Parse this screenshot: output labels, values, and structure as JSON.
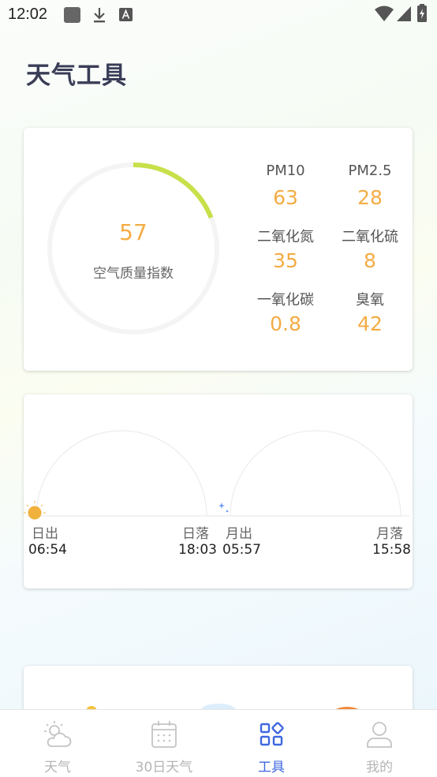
{
  "status_bar": {
    "time": "12:02"
  },
  "page": {
    "title": "天气工具"
  },
  "aqi": {
    "value": "57",
    "label": "空气质量指数",
    "progress_fraction": 0.19,
    "metrics": [
      {
        "name": "PM10",
        "value": "63"
      },
      {
        "name": "PM2.5",
        "value": "28"
      },
      {
        "name": "二氧化氮",
        "value": "35"
      },
      {
        "name": "二氧化硫",
        "value": "8"
      },
      {
        "name": "一氧化碳",
        "value": "0.8"
      },
      {
        "name": "臭氧",
        "value": "42"
      }
    ]
  },
  "sun_moon": {
    "sunrise_label": "日出",
    "sunrise_time": "06:54",
    "sunset_label": "日落",
    "sunset_time": "18:03",
    "moonrise_label": "月出",
    "moonrise_time": "05:57",
    "moonset_label": "月落",
    "moonset_time": "15:58"
  },
  "tabs": [
    {
      "label": "天气",
      "icon": "weather-icon",
      "active": false
    },
    {
      "label": "30日天气",
      "icon": "calendar-icon",
      "active": false
    },
    {
      "label": "工具",
      "icon": "tools-grid-icon",
      "active": true
    },
    {
      "label": "我的",
      "icon": "user-icon",
      "active": false
    }
  ],
  "colors": {
    "accent_orange": "#f4ac44",
    "gauge_green": "#c8e04a",
    "active_tab": "#3e67e0",
    "title": "#3a3d57"
  }
}
